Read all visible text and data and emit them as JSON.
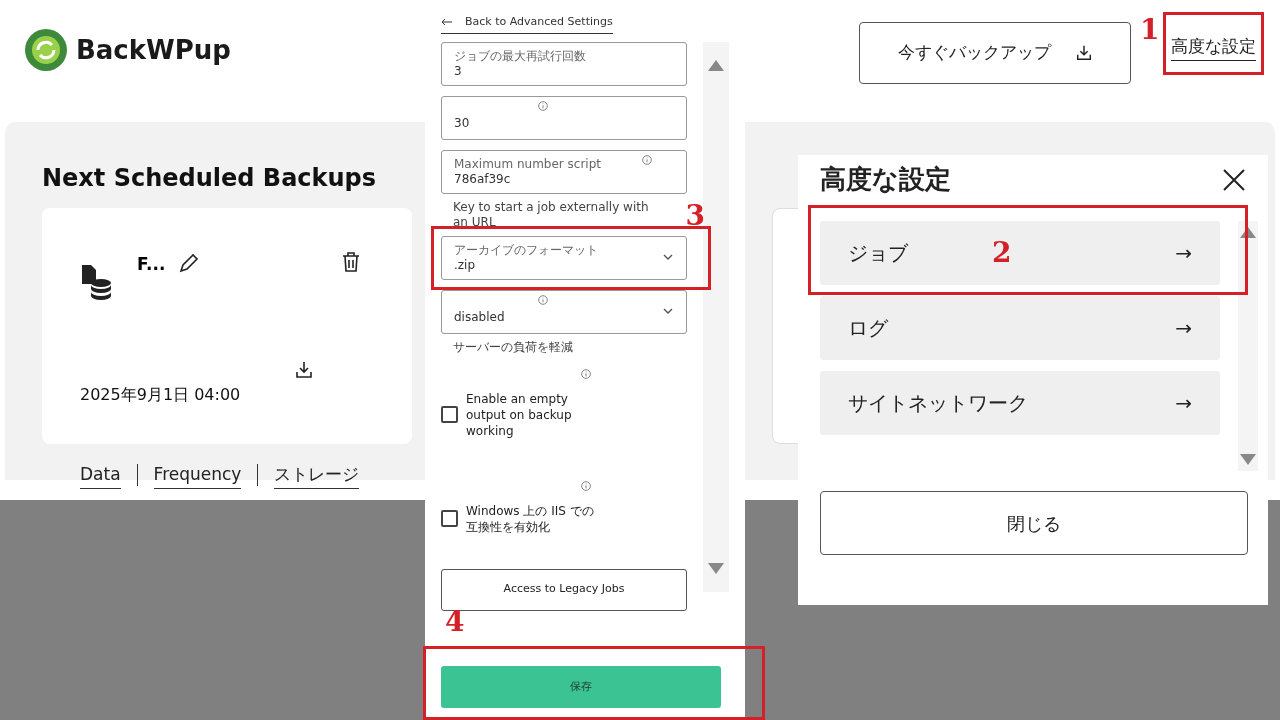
{
  "header": {
    "logo": "BackWPup",
    "backup_button": "今すぐバックアップ",
    "advanced_link": "高度な設定"
  },
  "dashboard": {
    "title": "Next Scheduled Backups",
    "card": {
      "name": "F...",
      "date": "2025年9月1日 04:00"
    },
    "tabs": [
      {
        "label": "Data"
      },
      {
        "label": "Frequency"
      },
      {
        "label": "ストレージ"
      }
    ]
  },
  "job_settings": {
    "back_link": "Back to Advanced Settings",
    "fields": [
      {
        "kind": "input",
        "label": "ジョブの最大再試行回数",
        "value": "3",
        "info": false
      },
      {
        "kind": "input",
        "value": "30",
        "info": true
      },
      {
        "kind": "input",
        "label": "Maximum number script",
        "value": "786af39c",
        "info": true
      },
      {
        "kind": "note",
        "text": "Key to start a job externally with an URL"
      },
      {
        "kind": "select",
        "label": "アーカイブのフォーマット",
        "value": ".zip",
        "info": false
      },
      {
        "kind": "select",
        "value": "disabled",
        "info": true
      },
      {
        "kind": "note",
        "text": "サーバーの負荷を軽減"
      },
      {
        "kind": "checkbox",
        "label": "Enable an empty output on backup working",
        "checked": false,
        "info": true
      },
      {
        "kind": "checkbox",
        "label": "Windows 上の IIS での互換性を有効化",
        "checked": false,
        "info": true
      },
      {
        "kind": "button",
        "label": "Access to Legacy Jobs"
      }
    ],
    "save_button": "保存"
  },
  "advanced_dialog": {
    "title": "高度な設定",
    "items": [
      {
        "label": "ジョブ",
        "arrow": "→"
      },
      {
        "label": "ログ",
        "arrow": "→"
      },
      {
        "label": "サイトネットワーク",
        "arrow": "→"
      }
    ],
    "close_button": "閉じる"
  },
  "annotations": [
    {
      "number": "1"
    },
    {
      "number": "2"
    },
    {
      "number": "3"
    },
    {
      "number": "4"
    }
  ]
}
